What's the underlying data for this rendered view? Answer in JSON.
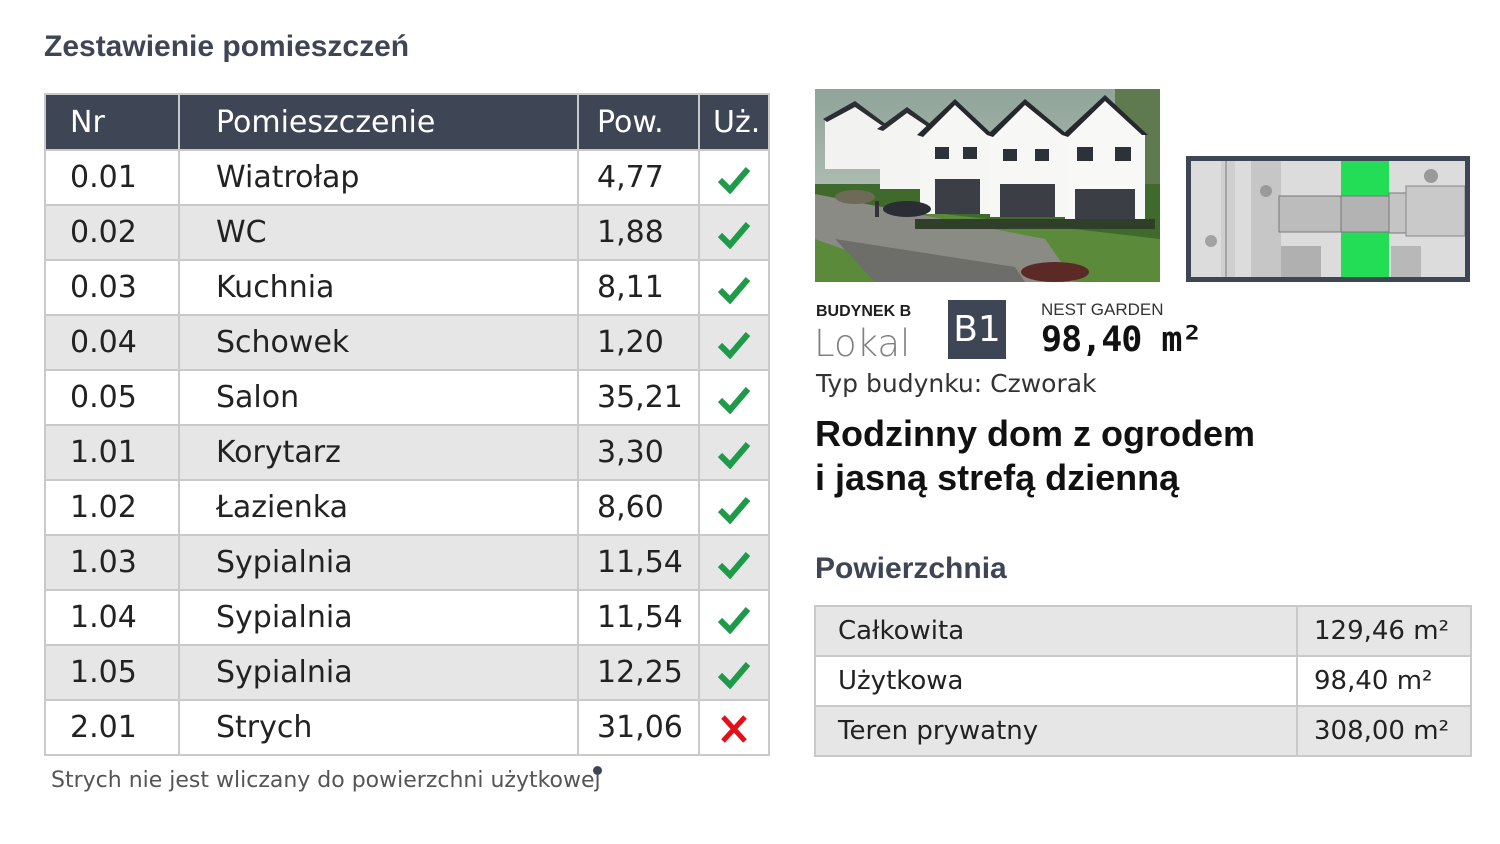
{
  "rooms_title": "Zestawienie pomieszczeń",
  "rooms_table": {
    "headers": [
      "Nr",
      "Pomieszczenie",
      "Pow.",
      "Uż."
    ],
    "rows": [
      {
        "nr": "0.01",
        "name": "Wiatrołap",
        "area": "4,77",
        "usable": true
      },
      {
        "nr": "0.02",
        "name": "WC",
        "area": "1,88",
        "usable": true
      },
      {
        "nr": "0.03",
        "name": "Kuchnia",
        "area": "8,11",
        "usable": true
      },
      {
        "nr": "0.04",
        "name": "Schowek",
        "area": "1,20",
        "usable": true
      },
      {
        "nr": "0.05",
        "name": "Salon",
        "area": "35,21",
        "usable": true
      },
      {
        "nr": "1.01",
        "name": "Korytarz",
        "area": "3,30",
        "usable": true
      },
      {
        "nr": "1.02",
        "name": "Łazienka",
        "area": "8,60",
        "usable": true
      },
      {
        "nr": "1.03",
        "name": "Sypialnia",
        "area": "11,54",
        "usable": true
      },
      {
        "nr": "1.04",
        "name": "Sypialnia",
        "area": "11,54",
        "usable": true
      },
      {
        "nr": "1.05",
        "name": "Sypialnia",
        "area": "12,25",
        "usable": true
      },
      {
        "nr": "2.01",
        "name": "Strych",
        "area": "31,06",
        "usable": false
      }
    ]
  },
  "footnote": "Strych nie jest wliczany do powierzchni użytkowej",
  "icons": {
    "usable_yes": "check-icon",
    "usable_no": "cross-icon"
  },
  "colors": {
    "header_bg": "#3e4656",
    "check": "#1f9a48",
    "cross": "#e3101c",
    "plot_highlight": "#22dd55"
  },
  "listing": {
    "building": "BUDYNEK B",
    "lokal_label": "Lokal",
    "unit": "B1",
    "project": "NEST GARDEN",
    "area": "98,40 m²",
    "type": "Typ budynku: Czworak",
    "headline_line1": "Rodzinny dom z ogrodem",
    "headline_line2": "i jasną strefą dzienną"
  },
  "surface": {
    "title": "Powierzchnia",
    "rows": [
      {
        "label": "Całkowita",
        "value": "129,46 m²"
      },
      {
        "label": "Użytkowa",
        "value": "98,40 m²"
      },
      {
        "label": "Teren prywatny",
        "value": "308,00 m²"
      }
    ]
  }
}
